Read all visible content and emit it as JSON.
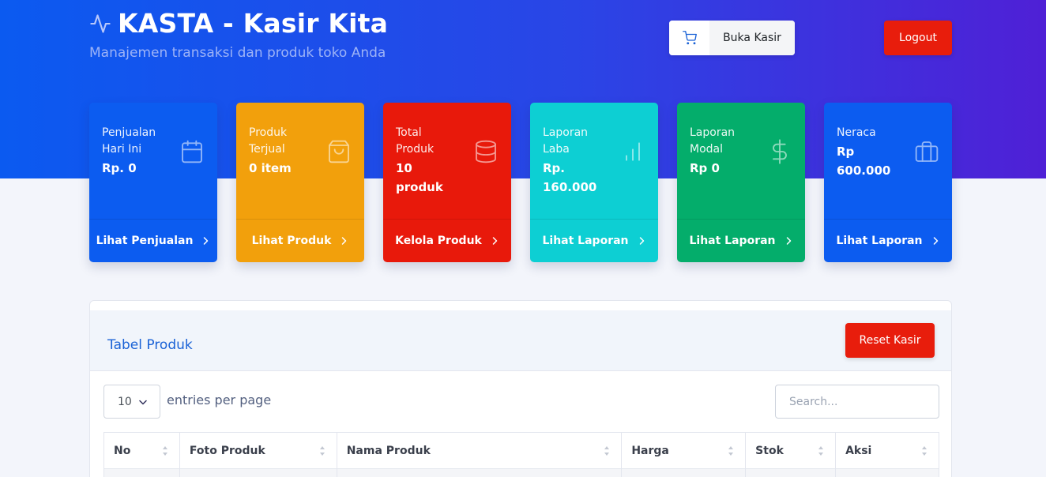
{
  "header": {
    "title": "KASTA - Kasir Kita",
    "subtitle": "Manajemen transaksi dan produk toko Anda",
    "logo_icon": "activity-icon",
    "open_cashier_label": "Buka Kasir",
    "open_cashier_icon": "cart-icon",
    "logout_label": "Logout"
  },
  "cards": [
    {
      "title": "Penjualan\nHari Ini",
      "value": "Rp. 0",
      "icon": "calendar-icon",
      "link": "Lihat Penjualan",
      "color": "#0c5cf0"
    },
    {
      "title": "Produk\nTerjual",
      "value": "0 item",
      "icon": "shopping-bag-icon",
      "link": "Lihat Produk",
      "color": "#f2a00c"
    },
    {
      "title": "Total\nProduk",
      "value": "10\nproduk",
      "icon": "database-icon",
      "link": "Kelola Produk",
      "color": "#e8190b"
    },
    {
      "title": "Laporan\nLaba",
      "value": "Rp.\n160.000",
      "icon": "bar-chart-icon",
      "link": "Lihat Laporan",
      "color": "#0dcfd3"
    },
    {
      "title": "Laporan\nModal",
      "value": "Rp 0",
      "icon": "dollar-icon",
      "link": "Lihat Laporan",
      "color": "#04ad6b"
    },
    {
      "title": "Neraca",
      "value": "Rp\n600.000",
      "icon": "briefcase-icon",
      "link": "Lihat Laporan",
      "color": "#0c5cf0"
    }
  ],
  "table_panel": {
    "title": "Tabel Produk",
    "reset_label": "Reset Kasir",
    "per_page_value": "10",
    "per_page_label": "entries per page",
    "search_placeholder": "Search...",
    "columns": [
      "No",
      "Foto Produk",
      "Nama Produk",
      "Harga",
      "Stok",
      "Aksi"
    ]
  }
}
